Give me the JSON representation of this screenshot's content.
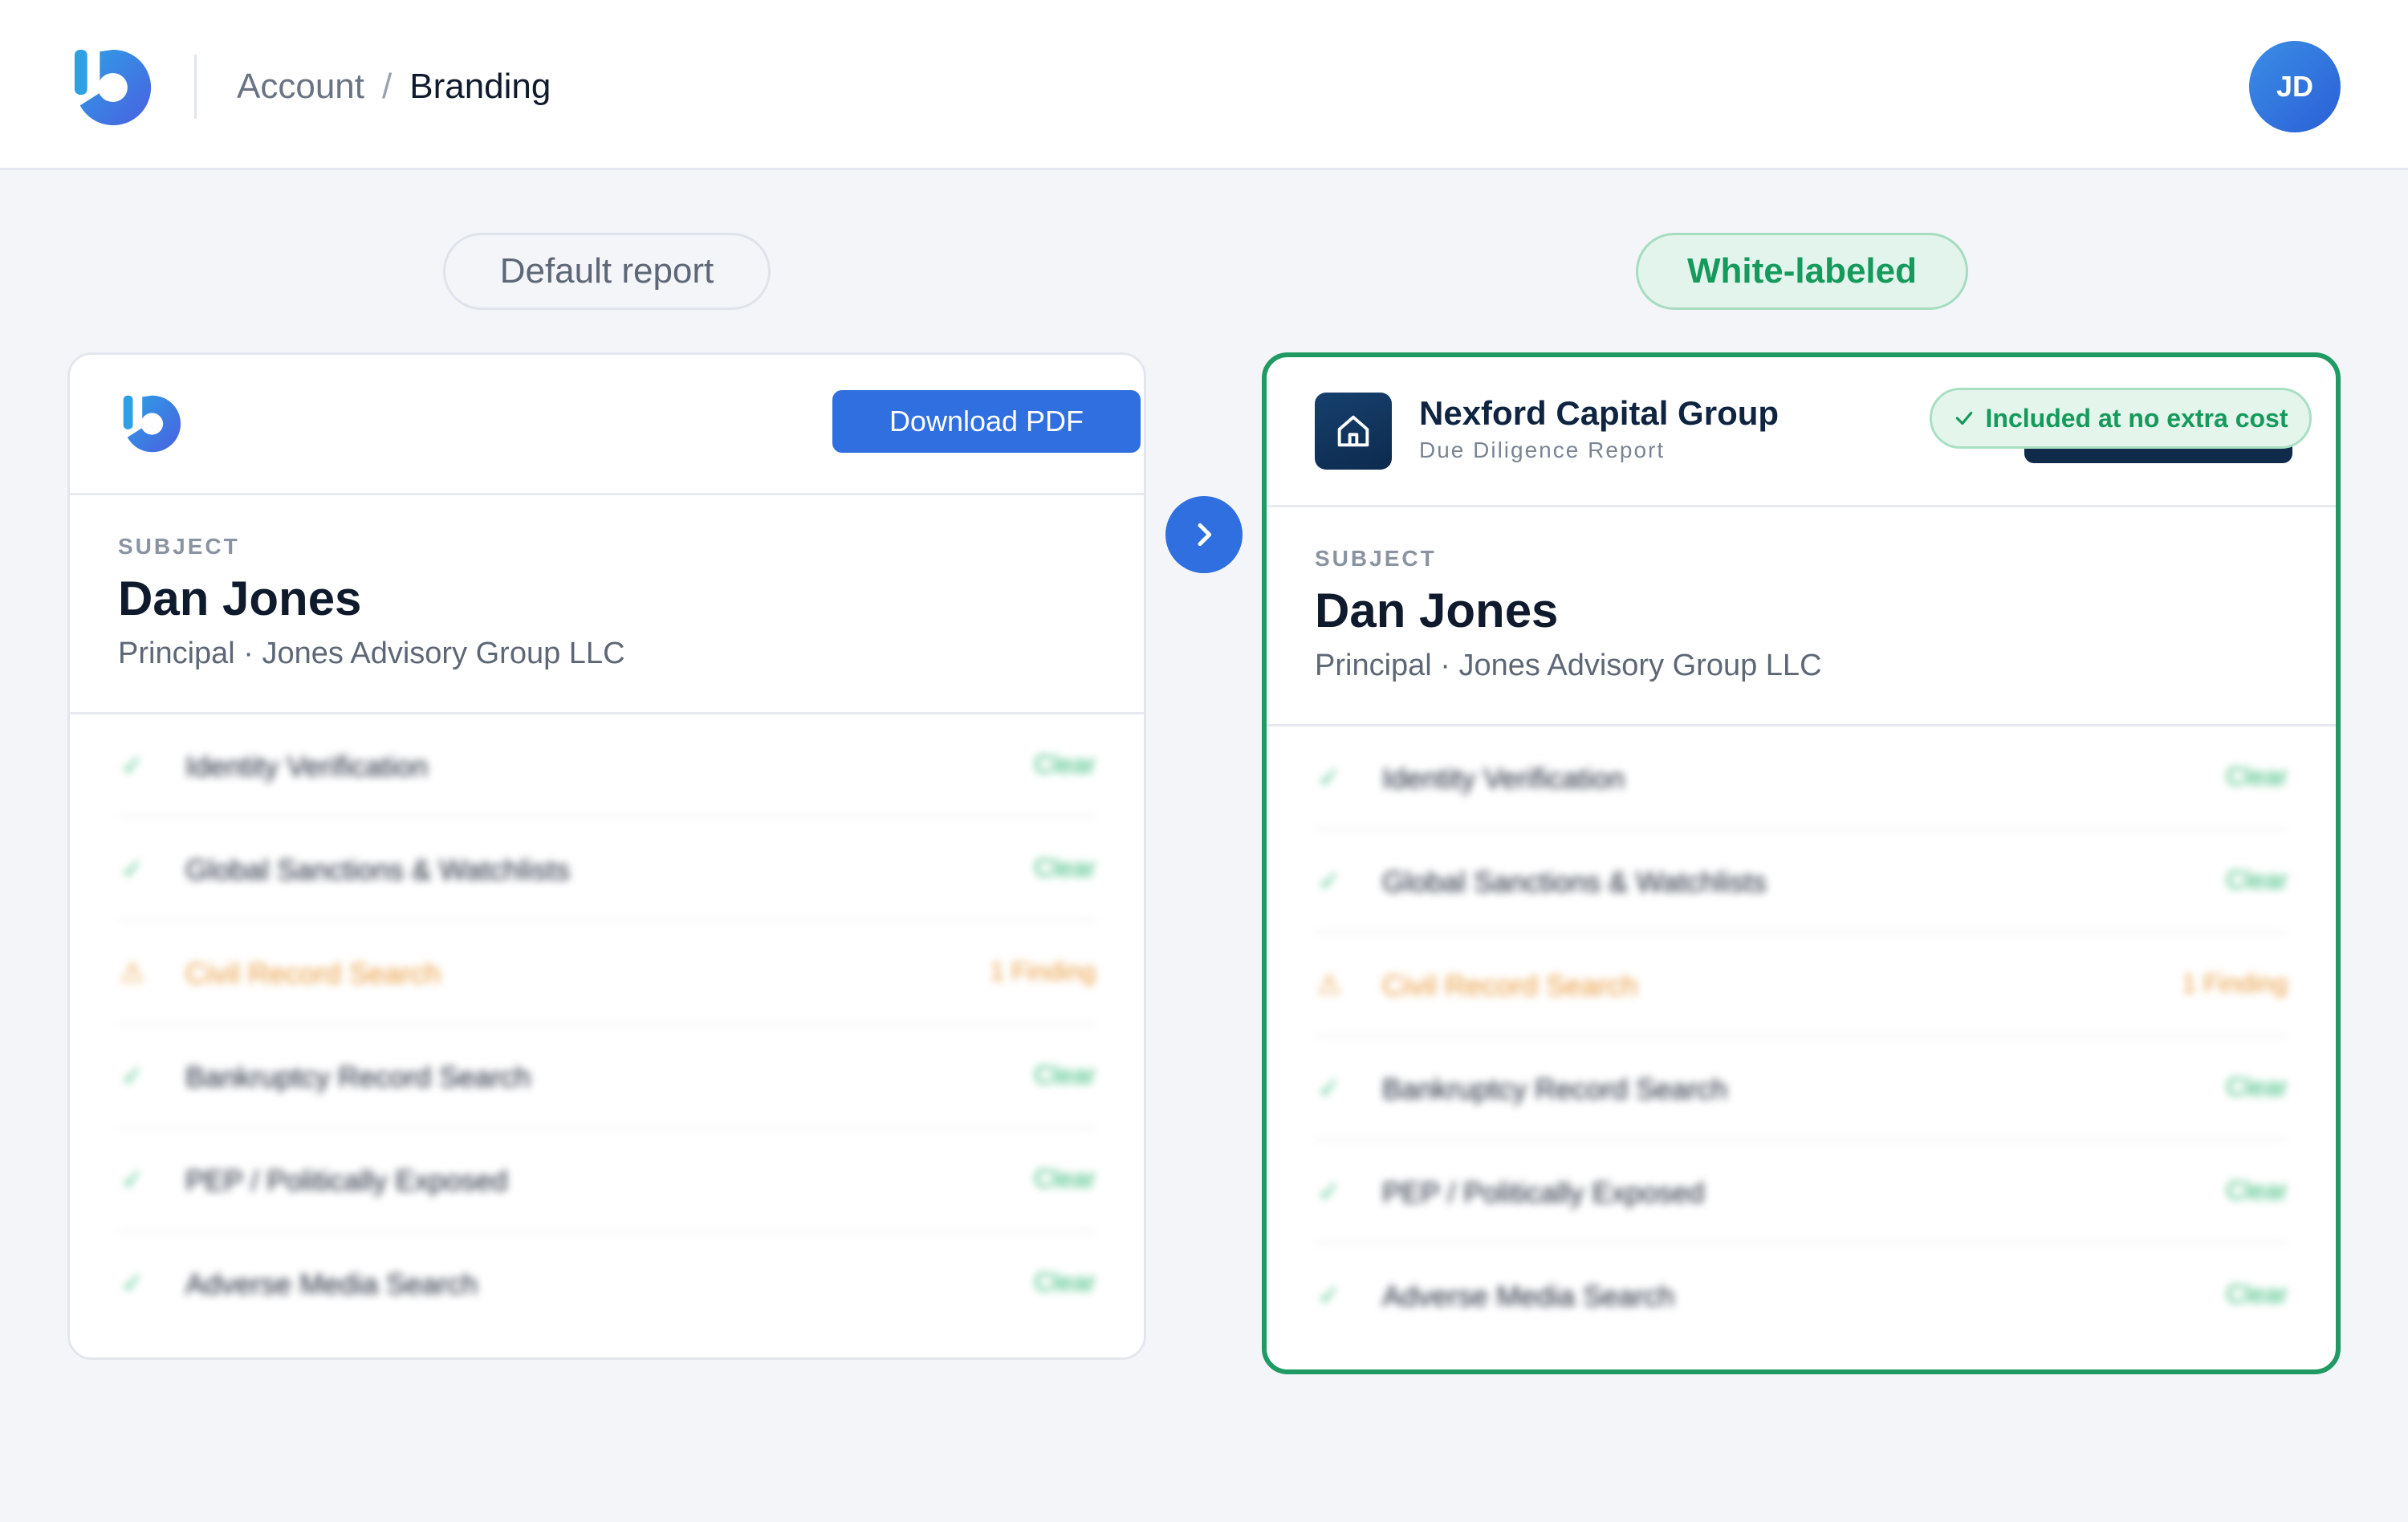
{
  "header": {
    "logo_icon": "app-logo-icon",
    "breadcrumb": {
      "parent": "Account",
      "separator": "/",
      "current": "Branding"
    },
    "avatar_initials": "JD"
  },
  "labels": {
    "default": "Default report",
    "white_labeled": "White-labeled"
  },
  "default_report": {
    "download_label": "Download PDF",
    "subject": {
      "label": "SUBJECT",
      "name": "Dan Jones",
      "role": "Principal · Jones Advisory Group LLC"
    },
    "checks": [
      {
        "name": "Identity Verification",
        "status": "Clear",
        "state": "clear"
      },
      {
        "name": "Global Sanctions & Watchlists",
        "status": "Clear",
        "state": "clear"
      },
      {
        "name": "Civil Record Search",
        "status": "1 Finding",
        "state": "warn"
      },
      {
        "name": "Bankruptcy Record Search",
        "status": "Clear",
        "state": "clear"
      },
      {
        "name": "PEP / Politically Exposed",
        "status": "Clear",
        "state": "clear"
      },
      {
        "name": "Adverse Media Search",
        "status": "Clear",
        "state": "clear"
      }
    ]
  },
  "white_labeled_report": {
    "brand_icon": "home-icon",
    "brand_name": "Nexford Capital Group",
    "brand_subtitle": "Due Diligence Report",
    "badge": "Included at no extra cost",
    "subject": {
      "label": "SUBJECT",
      "name": "Dan Jones",
      "role": "Principal · Jones Advisory Group LLC"
    },
    "checks": [
      {
        "name": "Identity Verification",
        "status": "Clear",
        "state": "clear"
      },
      {
        "name": "Global Sanctions & Watchlists",
        "status": "Clear",
        "state": "clear"
      },
      {
        "name": "Civil Record Search",
        "status": "1 Finding",
        "state": "warn"
      },
      {
        "name": "Bankruptcy Record Search",
        "status": "Clear",
        "state": "clear"
      },
      {
        "name": "PEP / Politically Exposed",
        "status": "Clear",
        "state": "clear"
      },
      {
        "name": "Adverse Media Search",
        "status": "Clear",
        "state": "clear"
      }
    ]
  },
  "colors": {
    "primary": "#2f6fe0",
    "success": "#159a5c",
    "warning": "#e89a3c",
    "brand_navy": "#0f2a4a"
  }
}
